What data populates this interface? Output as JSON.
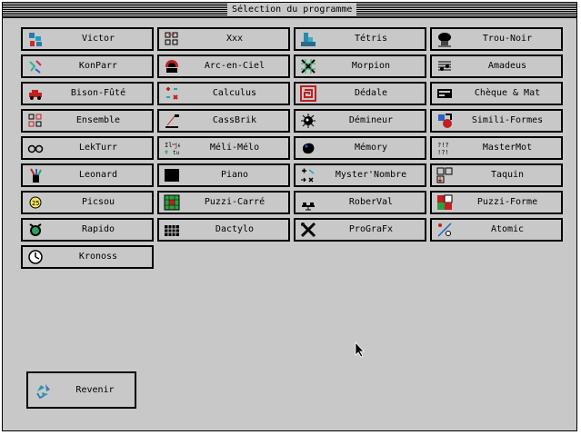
{
  "window": {
    "title": "Sélection du programme"
  },
  "programs": [
    {
      "label": "Victor",
      "icon": "victor-icon"
    },
    {
      "label": "Xxx",
      "icon": "xxx-icon"
    },
    {
      "label": "Tétris",
      "icon": "tetris-icon"
    },
    {
      "label": "Trou-Noir",
      "icon": "trou-noir-icon"
    },
    {
      "label": "KonParr",
      "icon": "konparr-icon"
    },
    {
      "label": "Arc-en-Ciel",
      "icon": "arc-en-ciel-icon"
    },
    {
      "label": "Morpion",
      "icon": "morpion-icon"
    },
    {
      "label": "Amadeus",
      "icon": "amadeus-icon"
    },
    {
      "label": "Bison-Fûté",
      "icon": "bison-fute-icon"
    },
    {
      "label": "Calculus",
      "icon": "calculus-icon"
    },
    {
      "label": "Dédale",
      "icon": "dedale-icon"
    },
    {
      "label": "Chèque & Mat",
      "icon": "cheque-mat-icon"
    },
    {
      "label": "Ensemble",
      "icon": "ensemble-icon"
    },
    {
      "label": "CassBrik",
      "icon": "cassbrik-icon"
    },
    {
      "label": "Démineur",
      "icon": "demineur-icon"
    },
    {
      "label": "Simili-Formes",
      "icon": "simili-formes-icon"
    },
    {
      "label": "LekTurr",
      "icon": "lekturr-icon"
    },
    {
      "label": "Méli-Mélo",
      "icon": "meli-melo-icon"
    },
    {
      "label": "Mémory",
      "icon": "memory-icon"
    },
    {
      "label": "MasterMot",
      "icon": "mastermot-icon"
    },
    {
      "label": "Leonard",
      "icon": "leonard-icon"
    },
    {
      "label": "Piano",
      "icon": "piano-icon"
    },
    {
      "label": "Myster'Nombre",
      "icon": "myster-nombre-icon"
    },
    {
      "label": "Taquin",
      "icon": "taquin-icon"
    },
    {
      "label": "Picsou",
      "icon": "picsou-icon"
    },
    {
      "label": "Puzzi-Carré",
      "icon": "puzzi-carre-icon"
    },
    {
      "label": "RoberVal",
      "icon": "roberval-icon"
    },
    {
      "label": "Puzzi-Forme",
      "icon": "puzzi-forme-icon"
    },
    {
      "label": "Rapido",
      "icon": "rapido-icon"
    },
    {
      "label": "Dactylo",
      "icon": "dactylo-icon"
    },
    {
      "label": "ProGraFx",
      "icon": "prografx-icon"
    },
    {
      "label": "Atomic",
      "icon": "atomic-icon"
    },
    {
      "label": "Kronoss",
      "icon": "kronoss-icon"
    }
  ],
  "back": {
    "label": "Revenir",
    "icon": "recycle-icon"
  }
}
